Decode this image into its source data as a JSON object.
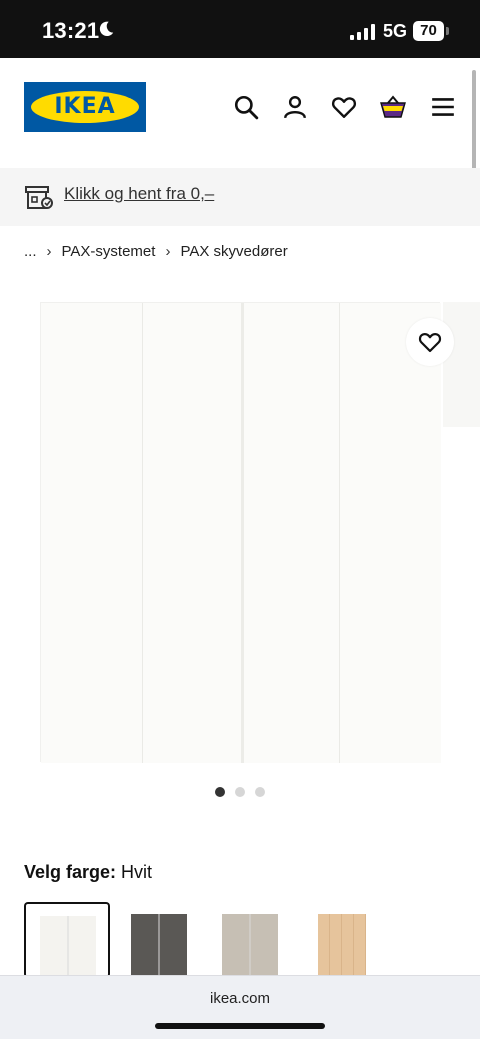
{
  "status_bar": {
    "time": "13:21",
    "network": "5G",
    "battery": "70"
  },
  "header": {
    "logo_text": "IKEA",
    "icons": [
      "search-icon",
      "account-icon",
      "heart-icon",
      "basket-icon",
      "menu-icon"
    ]
  },
  "promo": {
    "text": "Klikk og hent fra 0,–"
  },
  "breadcrumb": {
    "ellipsis": "...",
    "items": [
      "PAX-systemet",
      "PAX skyvedører"
    ]
  },
  "gallery": {
    "image_count": 3,
    "active_index": 0
  },
  "color_selector": {
    "label": "Velg farge:",
    "value": "Hvit",
    "swatch_colors": [
      "#f4f3ef",
      "#5a5855",
      "#c6bfb4",
      "#e6c49c"
    ]
  },
  "browser": {
    "url": "ikea.com"
  },
  "colors": {
    "ikea_blue": "#0058a3",
    "ikea_yellow": "#ffdb00"
  }
}
